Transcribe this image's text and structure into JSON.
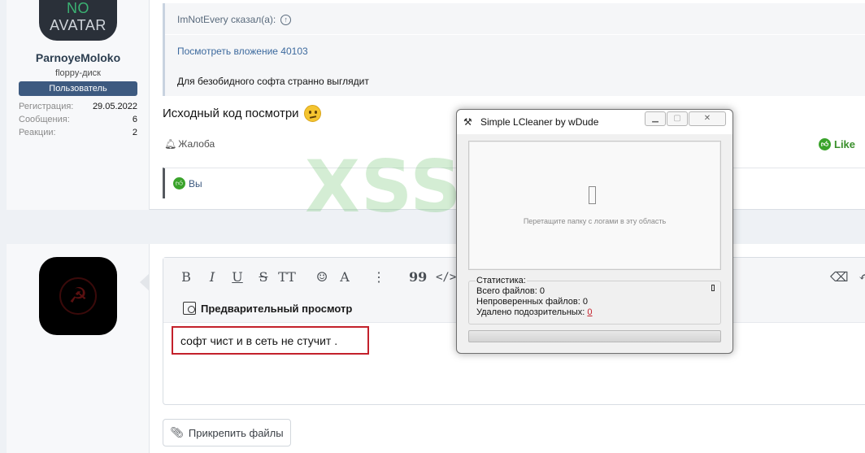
{
  "post1": {
    "avatar_text_no": "NO",
    "avatar_text_avatar": "AVATAR",
    "username": "ParnoyeMoloko",
    "user_title": "floppy-диск",
    "user_badge": "Пользователь",
    "stats": [
      {
        "label": "Регистрация:",
        "value": "29.05.2022"
      },
      {
        "label": "Сообщения:",
        "value": "6"
      },
      {
        "label": "Реакции:",
        "value": "2"
      }
    ],
    "quote": {
      "author_line": "ImNotEvery сказал(а):",
      "attachment_link": "Посмотреть вложение 40103",
      "text": "Для безобидного софта странно выглядит"
    },
    "body": "Исходный код посмотри",
    "report_label": "Жалоба",
    "like_label": "Like",
    "reaction_by": "Вы"
  },
  "editor": {
    "toolbar": [
      "B",
      "I",
      "U",
      "S",
      "TT",
      "☺",
      "A",
      "⋮",
      "99",
      "</>"
    ],
    "preview_label": "Предварительный просмотр",
    "typed_text": "софт чист и в сеть не стучит .",
    "attach_label": "Прикрепить файлы"
  },
  "watermark": "XSS.is",
  "dialog": {
    "title": "Simple LCleaner by wDude",
    "drop_hint": "Перетащите папку с логами в эту область",
    "stats_title": "Статистика:",
    "total_files": "Всего файлов: 0",
    "unverified_files": "Непроверенных файлов: 0",
    "removed_label": "Удалено подозрительных:",
    "removed_value": "0",
    "progress_percent": 0
  }
}
